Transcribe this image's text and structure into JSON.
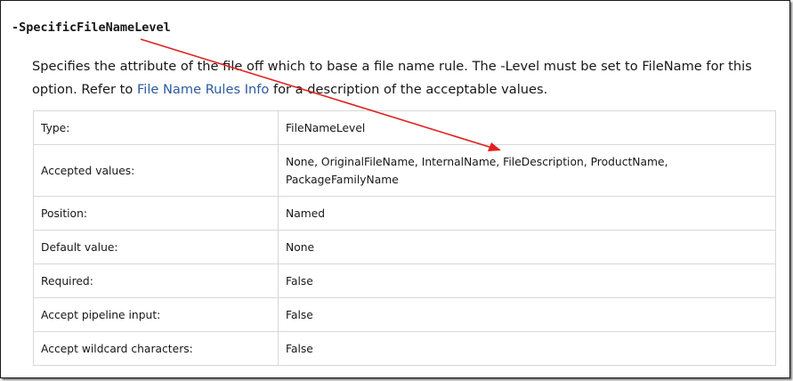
{
  "parameter": {
    "name": "-SpecificFileNameLevel"
  },
  "description": {
    "text_before_link": "Specifies the attribute of the file off which to base a file name rule. The -Level must be set to FileName for this option. Refer to ",
    "link_text": "File Name Rules Info",
    "text_after_link": " for a description of the acceptable values."
  },
  "table": {
    "rows": [
      {
        "label": "Type:",
        "value": "FileNameLevel"
      },
      {
        "label": "Accepted values:",
        "value": "None, OriginalFileName, InternalName, FileDescription, ProductName, PackageFamilyName"
      },
      {
        "label": "Position:",
        "value": "Named"
      },
      {
        "label": "Default value:",
        "value": "None"
      },
      {
        "label": "Required:",
        "value": "False"
      },
      {
        "label": "Accept pipeline input:",
        "value": "False"
      },
      {
        "label": "Accept wildcard characters:",
        "value": "False"
      }
    ]
  },
  "colors": {
    "link": "#2c5aa0",
    "annotation_arrow": "#e02020",
    "table_border": "#d8d8d8"
  },
  "annotation": {
    "icon": "red-arrow-icon"
  }
}
